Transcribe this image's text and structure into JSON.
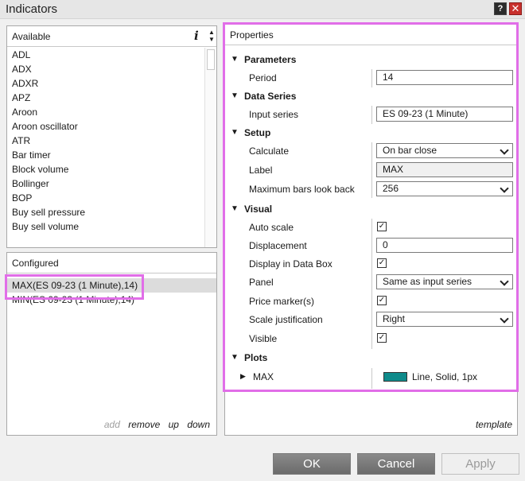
{
  "window": {
    "title": "Indicators",
    "help_glyph": "?",
    "close_glyph": "✕"
  },
  "available": {
    "header": "Available",
    "info_glyph": "i",
    "items": [
      "ADL",
      "ADX",
      "ADXR",
      "APZ",
      "Aroon",
      "Aroon oscillator",
      "ATR",
      "Bar timer",
      "Block volume",
      "Bollinger",
      "BOP",
      "Buy sell pressure",
      "Buy sell volume"
    ]
  },
  "configured": {
    "header": "Configured",
    "items": [
      "MAX(ES 09-23 (1 Minute),14)",
      "MIN(ES 09-23 (1 Minute),14)"
    ],
    "actions": {
      "add": "add",
      "remove": "remove",
      "up": "up",
      "down": "down"
    }
  },
  "properties": {
    "header": "Properties",
    "template_label": "template",
    "categories": {
      "parameters": "Parameters",
      "data_series": "Data Series",
      "setup": "Setup",
      "visual": "Visual",
      "plots": "Plots"
    },
    "period": {
      "label": "Period",
      "value": "14"
    },
    "input_series": {
      "label": "Input series",
      "value": "ES 09-23 (1 Minute)"
    },
    "calculate": {
      "label": "Calculate",
      "value": "On bar close"
    },
    "label": {
      "label": "Label",
      "value": "MAX"
    },
    "max_bars": {
      "label": "Maximum bars look back",
      "value": "256"
    },
    "auto_scale": {
      "label": "Auto scale",
      "checked": "✓"
    },
    "displacement": {
      "label": "Displacement",
      "value": "0"
    },
    "display_data_box": {
      "label": "Display in Data Box",
      "checked": "✓"
    },
    "panel": {
      "label": "Panel",
      "value": "Same as input series"
    },
    "price_marker": {
      "label": "Price marker(s)",
      "checked": "✓"
    },
    "scale_just": {
      "label": "Scale justification",
      "value": "Right"
    },
    "visible": {
      "label": "Visible",
      "checked": "✓"
    },
    "plot_max": {
      "label": "MAX",
      "desc": "Line, Solid, 1px",
      "color": "#0f8b8b"
    }
  },
  "buttons": {
    "ok": "OK",
    "cancel": "Cancel",
    "apply": "Apply"
  },
  "colors": {
    "highlight": "#e16ee8"
  }
}
